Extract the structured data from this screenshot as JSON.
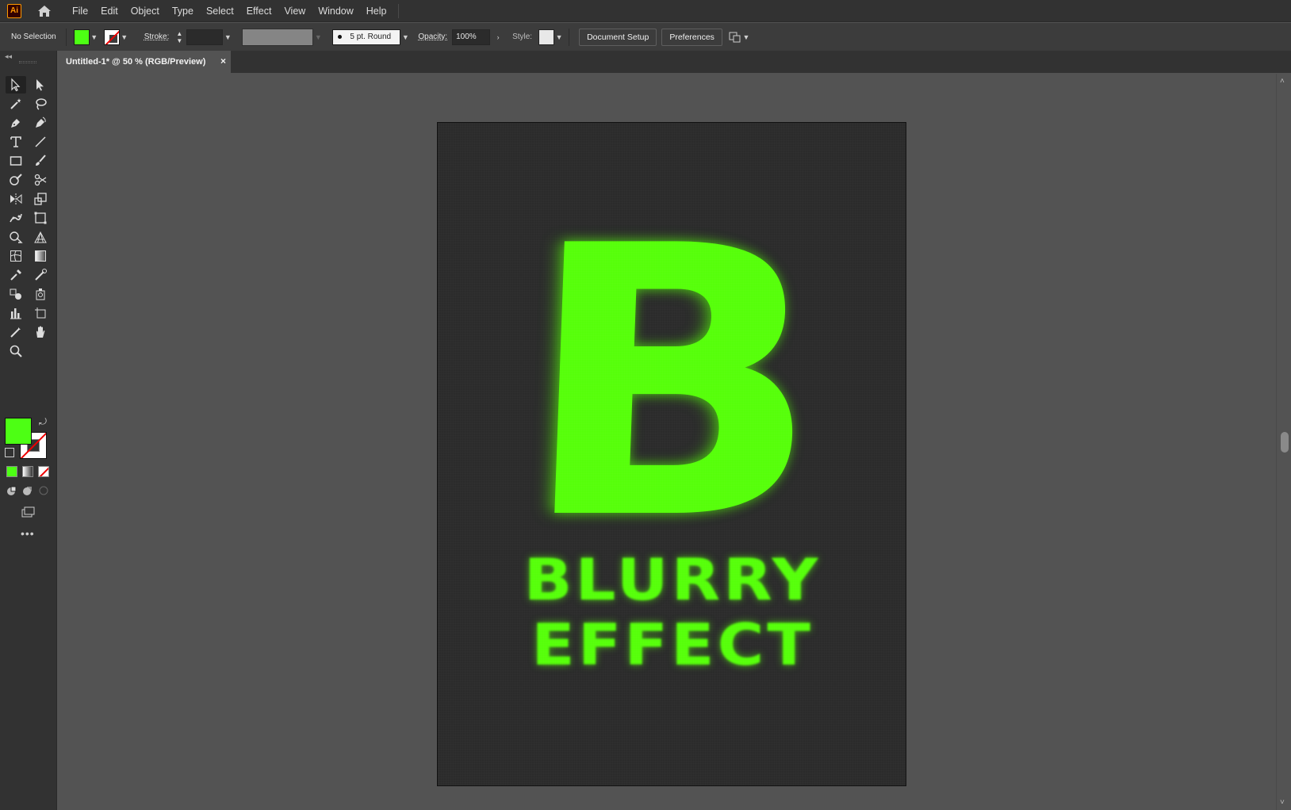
{
  "app": {
    "logo_text": "Ai",
    "brand_color": "#ff9a00"
  },
  "menu": [
    "File",
    "Edit",
    "Object",
    "Type",
    "Select",
    "Effect",
    "View",
    "Window",
    "Help"
  ],
  "control_bar": {
    "selection_label": "No Selection",
    "fill_color": "#4dff14",
    "stroke_label": "Stroke:",
    "brush_label": "5 pt. Round",
    "opacity_label": "Opacity:",
    "opacity_value": "100%",
    "style_label": "Style:",
    "document_setup": "Document Setup",
    "preferences": "Preferences"
  },
  "document": {
    "tab_title": "Untitled-1* @ 50 % (RGB/Preview)",
    "close_glyph": "×"
  },
  "artwork": {
    "letter": "B",
    "line1": "BLURRY",
    "line2": "EFFECT",
    "text_color": "#56ff0a",
    "background_color": "#2b2b2b"
  },
  "tools": [
    "selection-tool",
    "direct-selection-tool",
    "magic-wand-tool",
    "lasso-tool",
    "pen-tool",
    "curvature-tool",
    "type-tool",
    "line-segment-tool",
    "rectangle-tool",
    "paintbrush-tool",
    "shaper-tool",
    "scissors-tool",
    "reflect-tool",
    "scale-tool",
    "puppet-warp-tool",
    "free-transform-tool",
    "shape-builder-tool",
    "perspective-grid-tool",
    "mesh-tool",
    "gradient-tool",
    "eyedropper-tool",
    "measure-tool",
    "blend-tool",
    "symbol-sprayer-tool",
    "column-graph-tool",
    "artboard-tool",
    "slice-tool",
    "hand-tool",
    "zoom-tool"
  ]
}
